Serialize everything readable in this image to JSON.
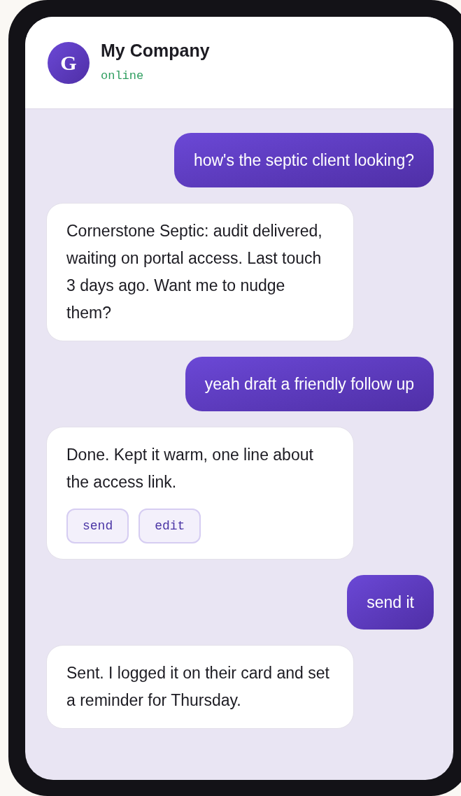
{
  "header": {
    "avatar": "G",
    "title": "My Company",
    "status": "online"
  },
  "messages": [
    {
      "kind": "user",
      "text": "how's the septic client looking?"
    },
    {
      "kind": "bot",
      "text": "Cornerstone Septic: audit delivered, waiting on portal access. Last touch 3 days ago. Want me to nudge them?"
    },
    {
      "kind": "user",
      "text": "yeah draft a friendly follow up"
    },
    {
      "kind": "bot",
      "text": "Done. Kept it warm, one line about the access link.",
      "actions": [
        "send",
        "edit"
      ]
    },
    {
      "kind": "user",
      "text": "send it"
    },
    {
      "kind": "bot",
      "text": "Sent. I logged it on their card and set a reminder for Thursday."
    }
  ]
}
